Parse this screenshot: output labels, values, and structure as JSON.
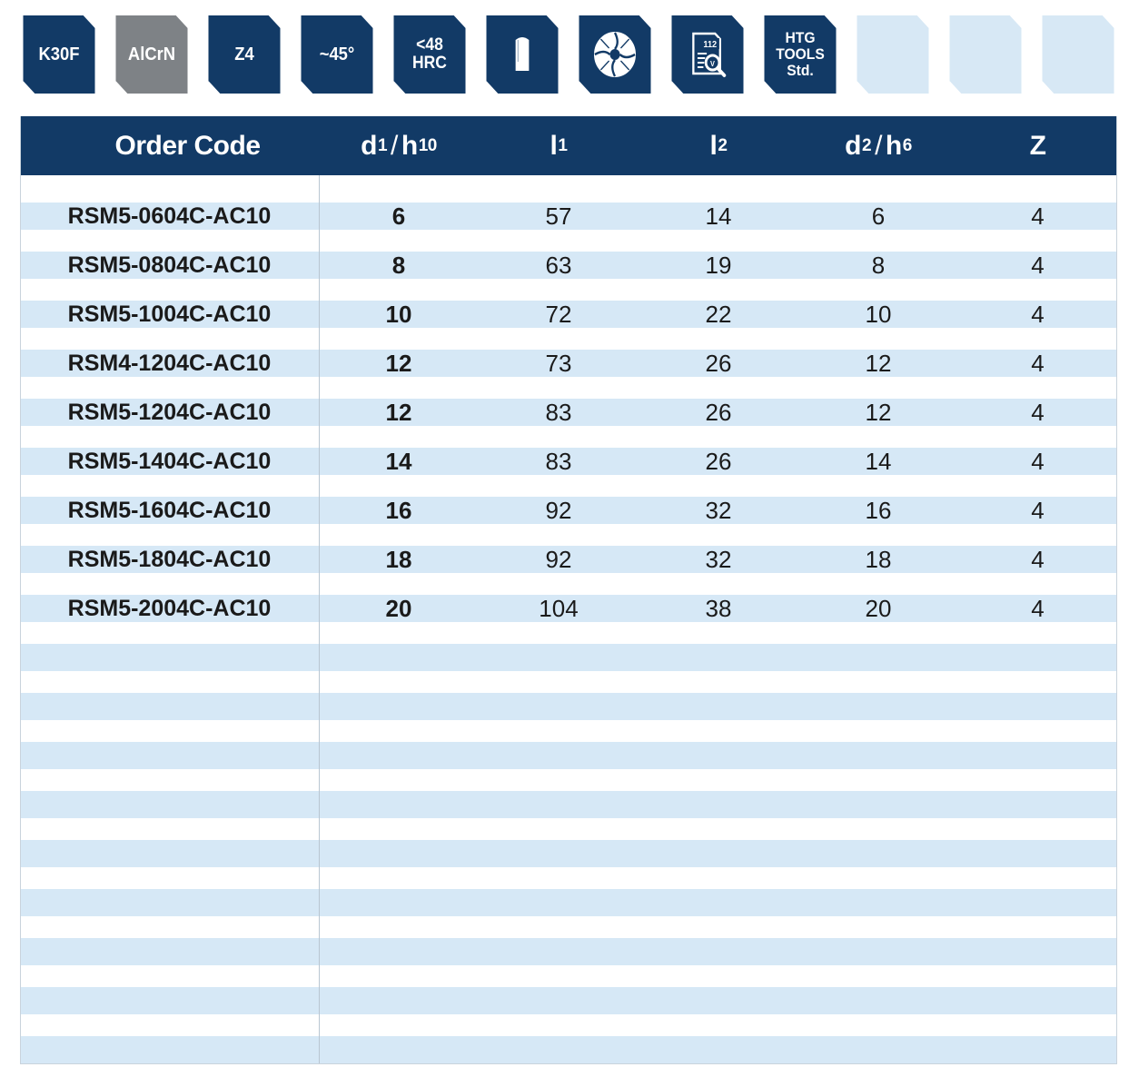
{
  "badges": [
    {
      "type": "text",
      "lines": [
        "K30F"
      ],
      "style": "dark"
    },
    {
      "type": "text",
      "lines": [
        "AlCrN"
      ],
      "style": "grey"
    },
    {
      "type": "text",
      "lines": [
        "Z4"
      ],
      "style": "dark"
    },
    {
      "type": "text",
      "lines": [
        "~45°"
      ],
      "style": "dark"
    },
    {
      "type": "text",
      "lines": [
        "<48",
        "HRC"
      ],
      "style": "dark"
    },
    {
      "type": "icon",
      "icon": "end-mill-shank-icon",
      "style": "dark"
    },
    {
      "type": "icon",
      "icon": "cutter-cross-section-icon",
      "style": "dark"
    },
    {
      "type": "icon",
      "icon": "cutting-data-page-icon",
      "icon_text": "112",
      "style": "dark"
    },
    {
      "type": "text",
      "lines": [
        "HTG",
        "TOOLS",
        "Std."
      ],
      "style": "dark"
    },
    {
      "type": "empty",
      "style": "empty"
    },
    {
      "type": "empty",
      "style": "empty"
    },
    {
      "type": "empty",
      "style": "empty"
    }
  ],
  "colors": {
    "header": "#123a66",
    "stripe": "#d6e8f6",
    "badge_grey": "#7e8286",
    "badge_empty": "#d7e8f5"
  },
  "table": {
    "headers": {
      "order_code": "Order Code",
      "d1": {
        "base": "d",
        "sub": "1",
        "slash": "/",
        "tol": "h",
        "tol_sub": "10"
      },
      "l1": {
        "base": "l",
        "sub": "1"
      },
      "l2": {
        "base": "l",
        "sub": "2"
      },
      "d2": {
        "base": "d",
        "sub": "2",
        "slash": "/",
        "tol": "h",
        "tol_sub": "6"
      },
      "z": "Z"
    },
    "rows": [
      {
        "code": "RSM5-0604C-AC10",
        "d1": "6",
        "l1": "57",
        "l2": "14",
        "d2": "6",
        "z": "4"
      },
      {
        "code": "RSM5-0804C-AC10",
        "d1": "8",
        "l1": "63",
        "l2": "19",
        "d2": "8",
        "z": "4"
      },
      {
        "code": "RSM5-1004C-AC10",
        "d1": "10",
        "l1": "72",
        "l2": "22",
        "d2": "10",
        "z": "4"
      },
      {
        "code": "RSM4-1204C-AC10",
        "d1": "12",
        "l1": "73",
        "l2": "26",
        "d2": "12",
        "z": "4"
      },
      {
        "code": "RSM5-1204C-AC10",
        "d1": "12",
        "l1": "83",
        "l2": "26",
        "d2": "12",
        "z": "4"
      },
      {
        "code": "RSM5-1404C-AC10",
        "d1": "14",
        "l1": "83",
        "l2": "26",
        "d2": "14",
        "z": "4"
      },
      {
        "code": "RSM5-1604C-AC10",
        "d1": "16",
        "l1": "92",
        "l2": "32",
        "d2": "16",
        "z": "4"
      },
      {
        "code": "RSM5-1804C-AC10",
        "d1": "18",
        "l1": "92",
        "l2": "32",
        "d2": "18",
        "z": "4"
      },
      {
        "code": "RSM5-2004C-AC10",
        "d1": "20",
        "l1": "104",
        "l2": "38",
        "d2": "20",
        "z": "4"
      }
    ]
  }
}
